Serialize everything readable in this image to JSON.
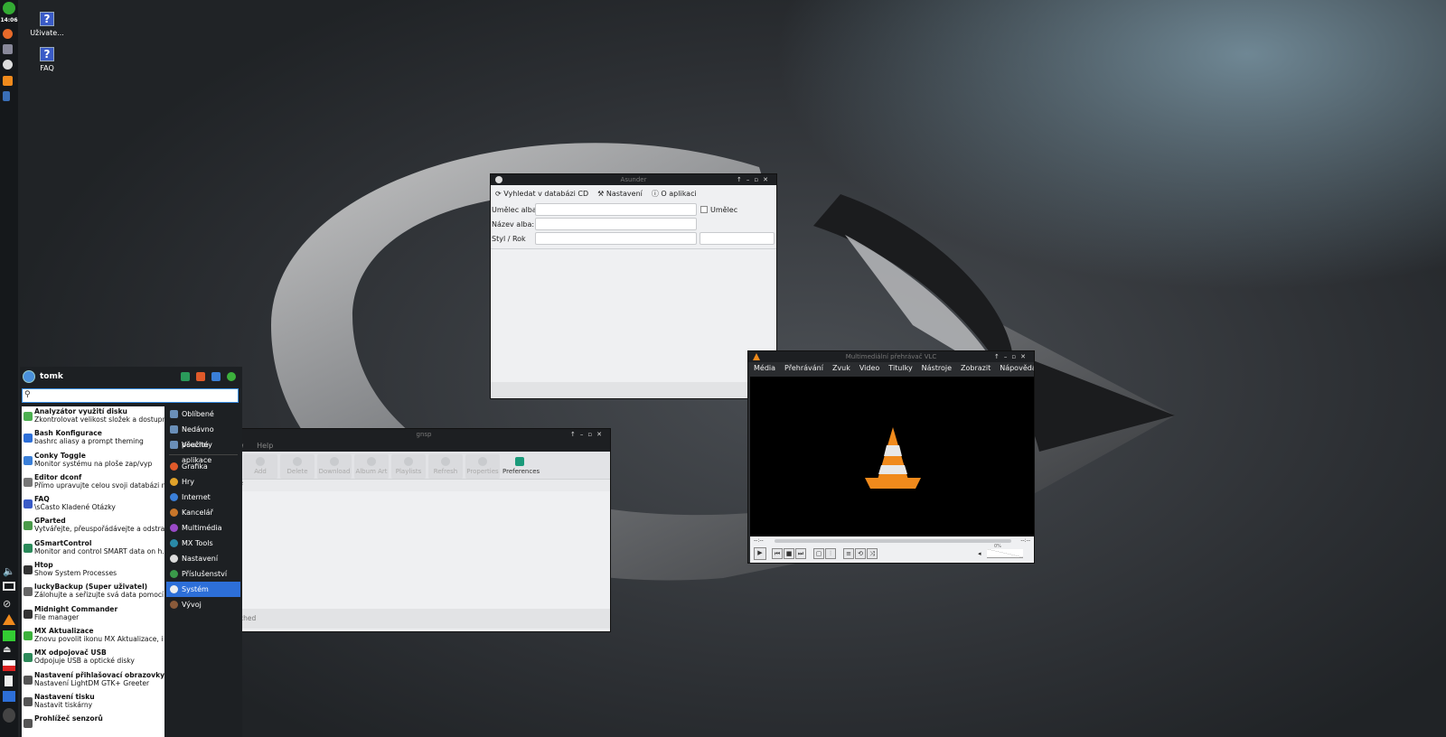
{
  "panel": {
    "clock": "14:06"
  },
  "desktop_icons": [
    {
      "label": "Uživate...",
      "icon": "help-icon"
    },
    {
      "label": "FAQ",
      "icon": "help-icon"
    }
  ],
  "asunder": {
    "title": "Asunder",
    "toolbar": {
      "lookup": "Vyhledat v databázi CD",
      "prefs": "Nastavení",
      "about": "O aplikaci"
    },
    "labels": {
      "artist": "Umělec alba:",
      "album": "Název alba:",
      "genre": "Styl / Rok"
    },
    "single_artist_label": "Umělec"
  },
  "ripper": {
    "title": "gnsp",
    "menu": [
      "w",
      "Help"
    ],
    "toolbar": [
      "Add",
      "Delete",
      "Download",
      "Album Art",
      "Playlists",
      "Refresh",
      "Properties",
      "Preferences"
    ],
    "list_header": "e",
    "status": "ched"
  },
  "vlc": {
    "title": "Multimediální přehrávač VLC",
    "menu": [
      "Média",
      "Přehrávání",
      "Zvuk",
      "Video",
      "Titulky",
      "Nástroje",
      "Zobrazit",
      "Nápověda"
    ],
    "time_left": "--:--",
    "time_right": "--:--",
    "volume": "0%"
  },
  "menu": {
    "user": "tomk",
    "apps": [
      {
        "title": "Analyzátor využití disku",
        "desc": "Zkontrolovat velikost složek a dostupn..."
      },
      {
        "title": "Bash Konfigurace",
        "desc": "bashrc aliasy a prompt theming"
      },
      {
        "title": "Conky Toggle",
        "desc": "Monitor systému na ploše zap/vyp"
      },
      {
        "title": "Editor dconf",
        "desc": "Přímo upravujte celou svoji databázi n..."
      },
      {
        "title": "FAQ",
        "desc": "\\sČasto Kladené Otázky"
      },
      {
        "title": "GParted",
        "desc": "Vytvářejte, přeuspořádávejte a odstra..."
      },
      {
        "title": "GSmartControl",
        "desc": "Monitor and control SMART data on h..."
      },
      {
        "title": "Htop",
        "desc": "Show System Processes"
      },
      {
        "title": "luckyBackup (Super uživatel)",
        "desc": "Zálohujte a seřizujte svá data pomocí ..."
      },
      {
        "title": "Midnight Commander",
        "desc": "File manager"
      },
      {
        "title": "MX Aktualizace",
        "desc": "Znovu povolit ikonu MX Aktualizace, i ..."
      },
      {
        "title": "MX odpojovač USB",
        "desc": "Odpojuje USB a optické disky"
      },
      {
        "title": "Nastavení přihlašovací obrazovky",
        "desc": "Nastavení LightDM GTK+ Greeter"
      },
      {
        "title": "Nastavení tisku",
        "desc": "Nastavit tiskárny"
      },
      {
        "title": "Prohlížeč senzorů",
        "desc": ""
      }
    ],
    "categories_top": [
      "Oblíbené",
      "Nedávno použité",
      "Všechny aplikace"
    ],
    "categories": [
      "Grafika",
      "Hry",
      "Internet",
      "Kancelář",
      "Multimédia",
      "MX Tools",
      "Nastavení",
      "Příslušenství",
      "Systém",
      "Vývoj"
    ]
  },
  "colors": {
    "accent": "#2d6fd8",
    "panel": "#15181b",
    "vlc_orange": "#f08a1c"
  }
}
